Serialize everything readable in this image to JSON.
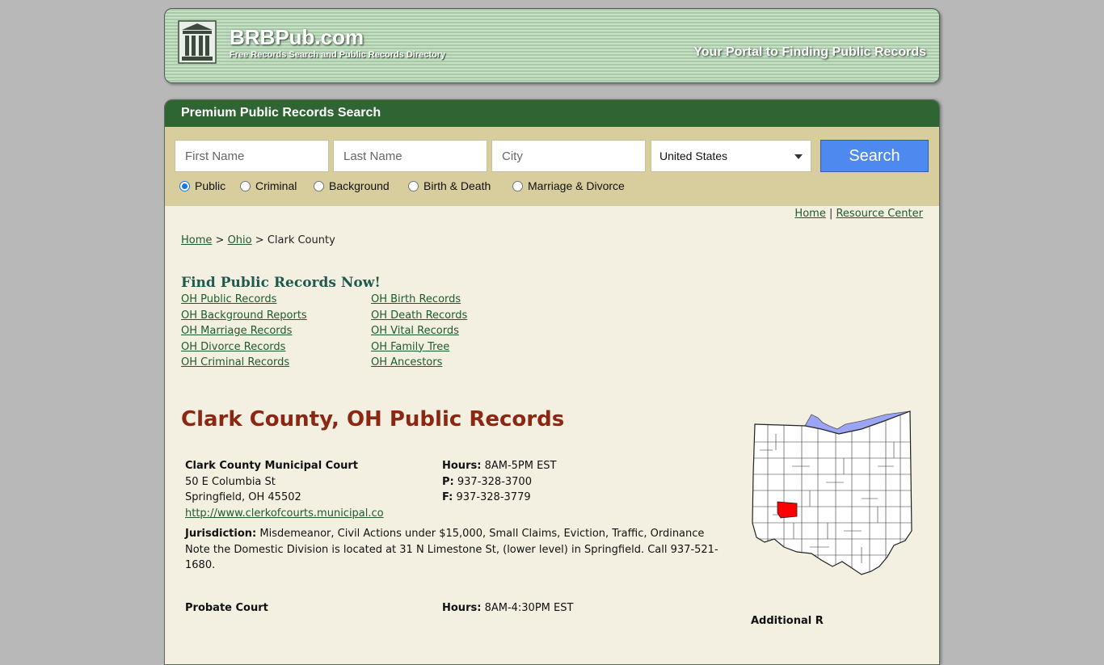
{
  "header": {
    "brand": "BRBPub.com",
    "brand_sub": "Free Records Search and Public Records Directory",
    "tagline": "Your Portal to Finding Public Records"
  },
  "search": {
    "panel_title": "Premium Public Records Search",
    "first_name_placeholder": "First Name",
    "last_name_placeholder": "Last Name",
    "city_placeholder": "City",
    "country": "United States",
    "button": "Search",
    "types": [
      "Public",
      "Criminal",
      "Background",
      "Birth & Death",
      "Marriage & Divorce"
    ],
    "selected_type": "Public"
  },
  "toplinks": {
    "home": "Home",
    "separator": "|",
    "resource": "Resource Center"
  },
  "breadcrumb": {
    "home": "Home",
    "sep": ">",
    "state": "Ohio",
    "current": "Clark County"
  },
  "find": {
    "title": "Find Public Records Now!",
    "left": [
      "OH Public Records",
      "OH Background Reports",
      "OH Marriage Records",
      "OH Divorce Records",
      "OH Criminal Records"
    ],
    "right": [
      "OH Birth Records",
      "OH Death Records",
      "OH Vital Records",
      "OH Family Tree",
      "OH Ancestors"
    ]
  },
  "county_title": "Clark County, OH Public Records",
  "offices": [
    {
      "name": "Clark County Municipal Court",
      "street": "50 E Columbia St",
      "city": "Springfield, OH 45502",
      "url": "http://www.clerkofcourts.municipal.co",
      "hours_label": "Hours:",
      "hours": "8AM-5PM EST",
      "phone_label": "P:",
      "phone": "937-328-3700",
      "fax_label": "F:",
      "fax": "937-328-3779",
      "jurisdiction_label": "Jurisdiction:",
      "jurisdiction": "Misdemeanor, Civil Actions under $15,000, Small Claims, Eviction, Traffic, Ordinance",
      "note": "Note the Domestic Division is located at 31 N Limestone St, (lower level) in Springfield. Call 937-521-1680."
    },
    {
      "name": "Probate Court",
      "hours_label": "Hours:",
      "hours": "8AM-4:30PM EST"
    }
  ],
  "additional": "Additional R",
  "colors": {
    "header_green": "#2f6433",
    "search_tan": "#d8cd9c",
    "content_bg": "#f3f0e1",
    "title_red": "#8b2713",
    "button_blue": "#4d89ee",
    "county_highlight": "#ff0000",
    "lake": "#9aa6f5"
  }
}
